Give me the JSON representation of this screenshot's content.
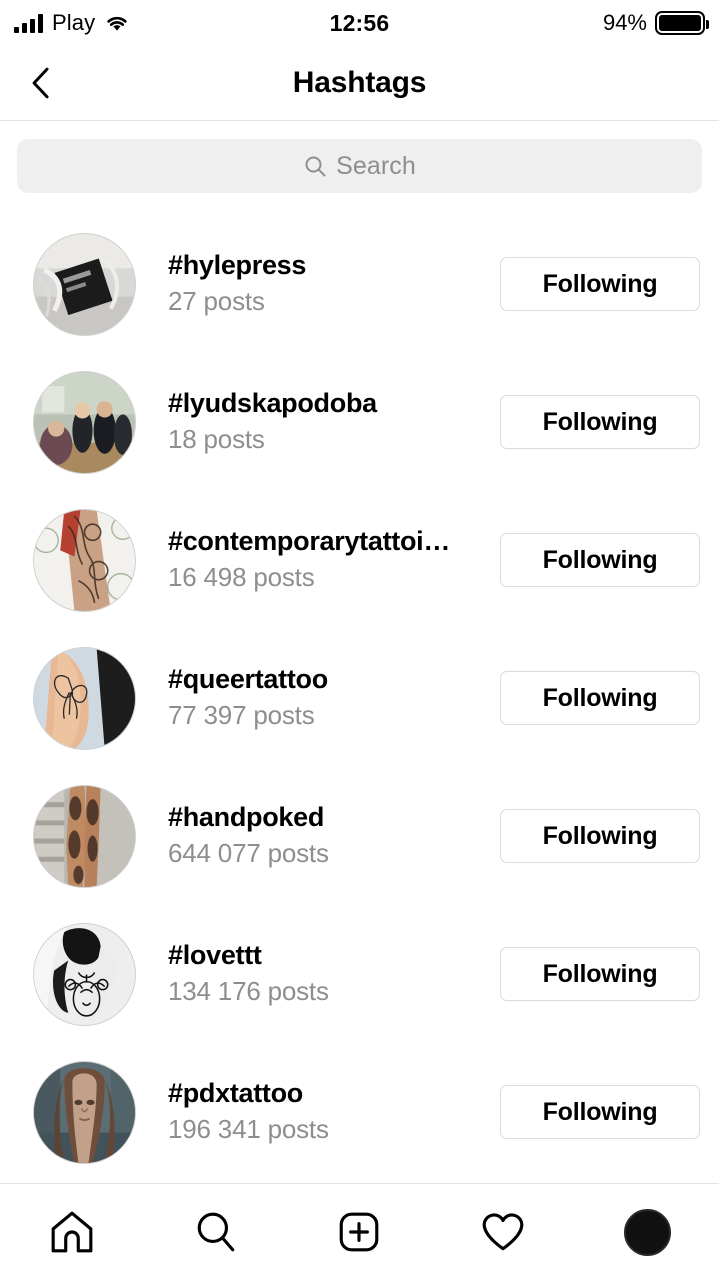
{
  "status_bar": {
    "carrier": "Play",
    "time": "12:56",
    "battery_percent": "94%",
    "signal_icon": "cellular-signal-icon",
    "wifi_icon": "wifi-icon",
    "battery_icon": "battery-icon"
  },
  "header": {
    "title": "Hashtags",
    "back_icon": "chevron-left-icon"
  },
  "search": {
    "placeholder": "Search",
    "icon": "search-icon"
  },
  "list": {
    "items": [
      {
        "tag": "#hylepress",
        "posts": "27 posts",
        "action": "Following",
        "avatar": "avatar-hylepress"
      },
      {
        "tag": "#lyudskapodoba",
        "posts": "18 posts",
        "action": "Following",
        "avatar": "avatar-lyudskapodoba"
      },
      {
        "tag": "#contemporarytattoi…",
        "posts": "16 498 posts",
        "action": "Following",
        "avatar": "avatar-contemporarytattoi"
      },
      {
        "tag": "#queertattoo",
        "posts": "77 397 posts",
        "action": "Following",
        "avatar": "avatar-queertattoo"
      },
      {
        "tag": "#handpoked",
        "posts": "644 077 posts",
        "action": "Following",
        "avatar": "avatar-handpoked"
      },
      {
        "tag": "#lovettt",
        "posts": "134 176 posts",
        "action": "Following",
        "avatar": "avatar-lovettt"
      },
      {
        "tag": "#pdxtattoo",
        "posts": "196 341 posts",
        "action": "Following",
        "avatar": "avatar-pdxtattoo"
      }
    ]
  },
  "tab_bar": {
    "tabs": [
      {
        "name": "home-icon"
      },
      {
        "name": "search-icon"
      },
      {
        "name": "add-post-icon"
      },
      {
        "name": "heart-icon"
      },
      {
        "name": "profile-avatar-icon"
      }
    ]
  },
  "colors": {
    "background": "#ffffff",
    "text_primary": "#000000",
    "text_secondary": "#8e8e8e",
    "search_field": "#efefef",
    "border": "#dbdbdb",
    "divider": "#e4e4e4"
  }
}
